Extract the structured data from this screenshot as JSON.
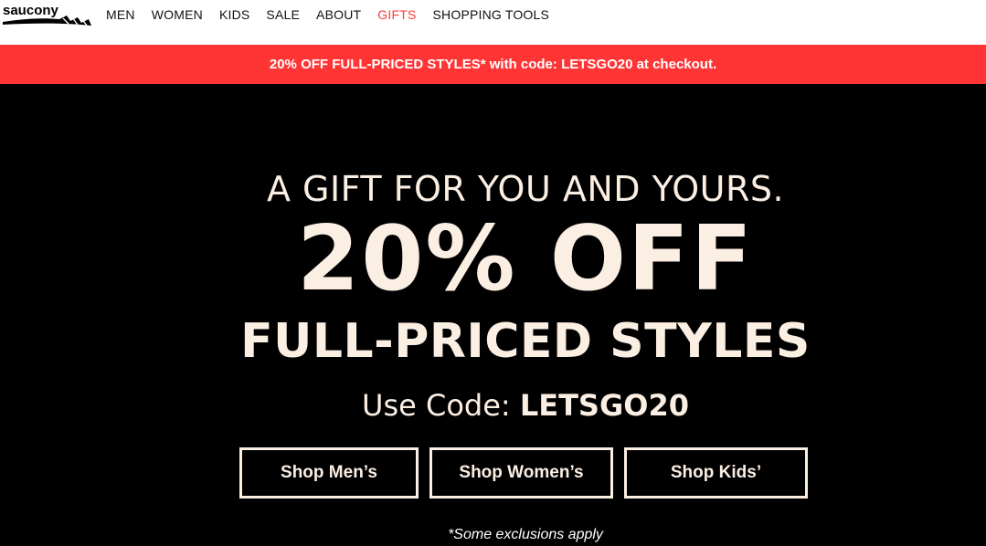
{
  "header": {
    "logo_text": "saucony",
    "nav": [
      {
        "label": "MEN"
      },
      {
        "label": "WOMEN"
      },
      {
        "label": "KIDS"
      },
      {
        "label": "SALE"
      },
      {
        "label": "ABOUT"
      },
      {
        "label": "GIFTS"
      },
      {
        "label": "SHOPPING TOOLS"
      }
    ]
  },
  "promo_bar": {
    "text": "20% OFF FULL-PRICED STYLES* with code: LETSGO20 at checkout."
  },
  "hero": {
    "subtitle": "A GIFT FOR YOU AND YOURS.",
    "headline": "20% OFF",
    "subheadline": "FULL-PRICED STYLES",
    "code_prefix": "Use Code: ",
    "code": "LETSGO20",
    "buttons": [
      {
        "label": "Shop Men’s"
      },
      {
        "label": "Shop Women’s"
      },
      {
        "label": "Shop Kids’"
      }
    ],
    "disclaimer": "*Some exclusions apply"
  },
  "colors": {
    "promo_bg": "#ff3535",
    "hero_bg": "#000000",
    "hero_text": "#fbeee3",
    "gifts_nav": "#ff3b3b"
  }
}
